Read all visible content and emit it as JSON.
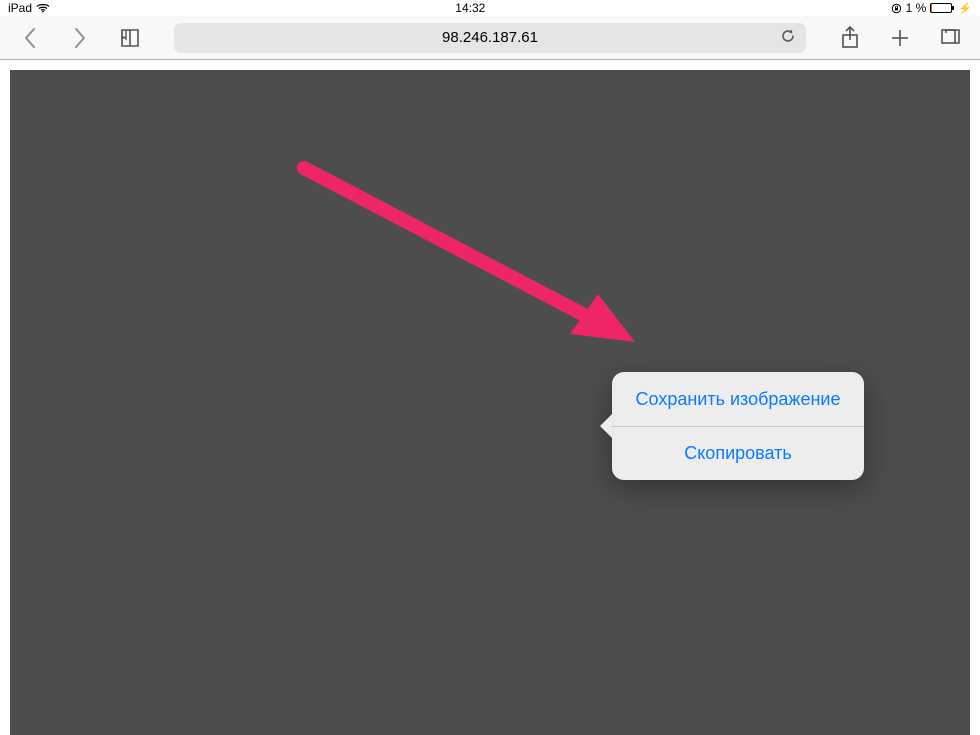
{
  "status": {
    "device": "iPad",
    "time": "14:32",
    "battery_percent_label": "1 %",
    "battery_fill_pct": 5
  },
  "toolbar": {
    "address": "98.246.187.61"
  },
  "popover": {
    "save_image": "Сохранить изображение",
    "copy": "Скопировать"
  },
  "annotation": {
    "arrow_color": "#ef2666"
  }
}
